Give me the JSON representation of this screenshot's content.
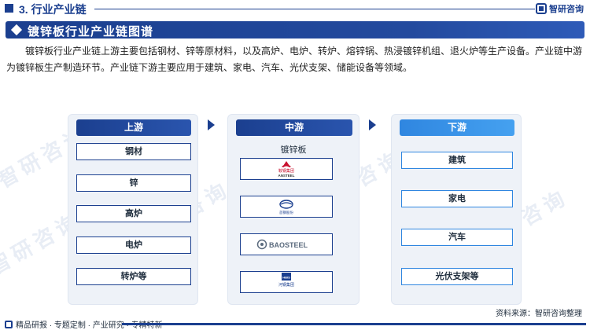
{
  "header": {
    "section_title": "3. 行业产业链",
    "brand": "智研咨询"
  },
  "banner": {
    "title": "镀锌板行业产业链图谱"
  },
  "description": "镀锌板行业产业链上游主要包括钢材、锌等原材料，以及高炉、电炉、转炉、熔锌锅、热浸镀锌机组、退火炉等生产设备。产业链中游为镀锌板生产制造环节。产业链下游主要应用于建筑、家电、汽车、光伏支架、储能设备等领域。",
  "watermark": "智研咨询",
  "columns": {
    "upstream": {
      "title": "上游",
      "items": [
        "钢材",
        "锌",
        "高炉",
        "电炉",
        "转炉等"
      ]
    },
    "midstream": {
      "title": "中游",
      "label": "镀锌板",
      "companies": [
        {
          "name": "鞍钢集团",
          "sub": "ANSTEEL",
          "icon": "ansteel-logo-icon",
          "color": "#c8102e"
        },
        {
          "name": "首钢股份",
          "icon": "shougang-logo-icon",
          "color": "#1b3f8f"
        },
        {
          "name": "BAOSTEEL",
          "icon": "baosteel-logo-icon",
          "color": "#5a6a7d"
        },
        {
          "name": "河钢集团",
          "sub": "HBIS",
          "icon": "hbis-logo-icon",
          "color": "#1b3f8f"
        }
      ]
    },
    "downstream": {
      "title": "下游",
      "items": [
        "建筑",
        "家电",
        "汽车",
        "光伏支架等"
      ]
    }
  },
  "footer": {
    "tags": "精品研报 · 专题定制 · 产业研究 · 专精特新",
    "source": "资料来源：智研咨询整理"
  }
}
